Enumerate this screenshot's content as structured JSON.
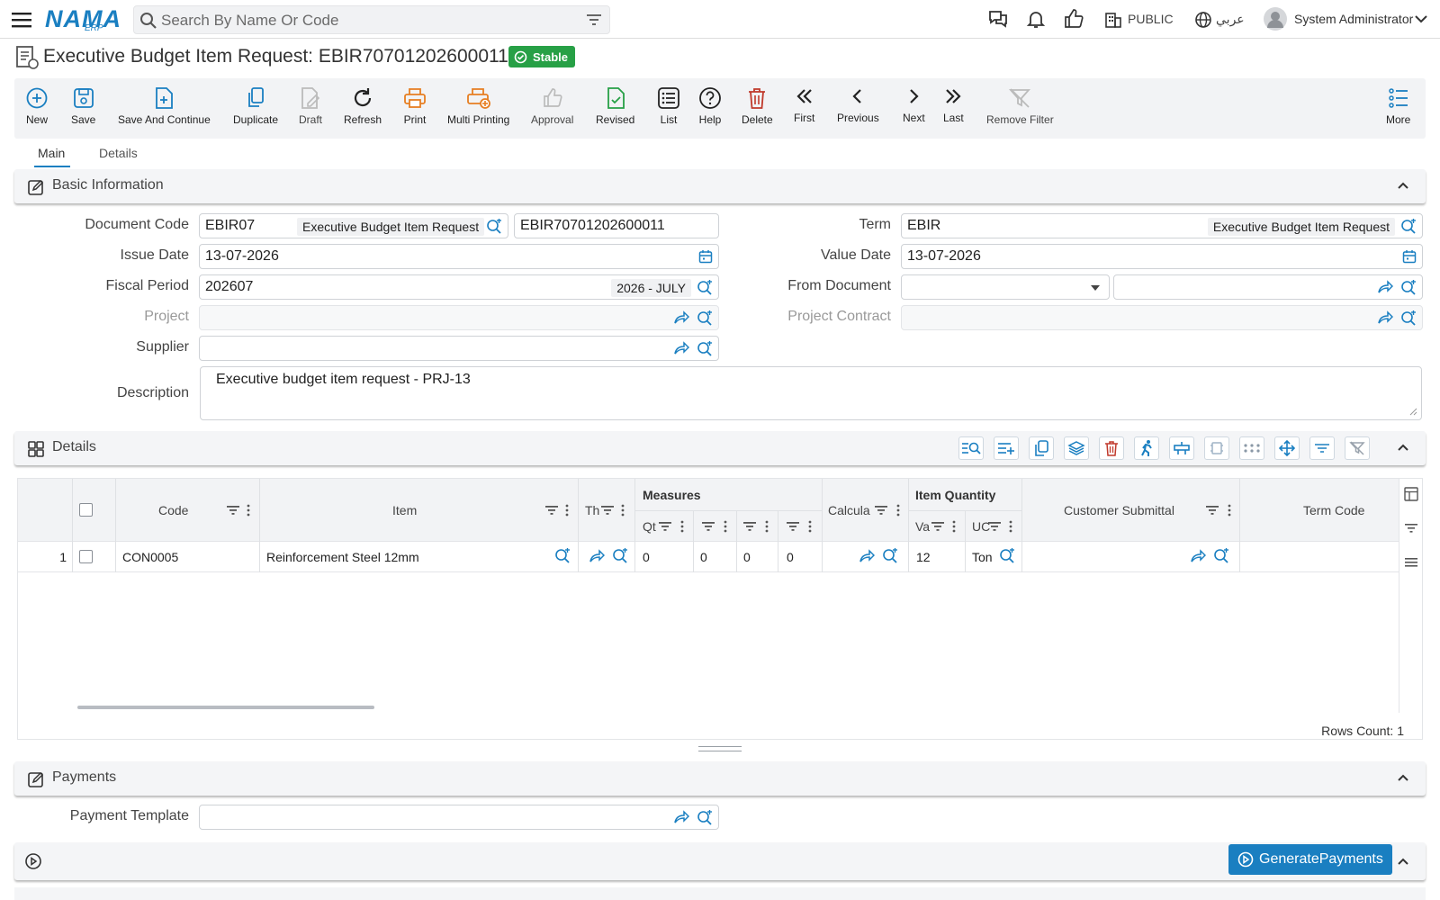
{
  "topbar": {
    "logo_text": "NAMA",
    "logo_sub": "ERP",
    "search_placeholder": "Search By Name Or Code",
    "branch": "PUBLIC",
    "language": "عربي",
    "user": "System Administrator"
  },
  "page": {
    "title": "Executive Budget Item Request: EBIR70701202600011",
    "status": "Stable"
  },
  "toolbar": {
    "new": "New",
    "save": "Save",
    "save_continue": "Save And Continue",
    "duplicate": "Duplicate",
    "draft": "Draft",
    "refresh": "Refresh",
    "print": "Print",
    "multi_printing": "Multi Printing",
    "approval": "Approval",
    "revised": "Revised",
    "list": "List",
    "help": "Help",
    "delete": "Delete",
    "first": "First",
    "previous": "Previous",
    "next": "Next",
    "last": "Last",
    "remove_filter": "Remove Filter",
    "more": "More"
  },
  "tabs": {
    "main": "Main",
    "details": "Details"
  },
  "basic": {
    "header": "Basic Information",
    "document_code_label": "Document Code",
    "document_code": "EBIR07",
    "document_code_name": "Executive Budget Item Request",
    "document_number": "EBIR70701202600011",
    "term_label": "Term",
    "term": "EBIR",
    "term_name": "Executive Budget Item Request",
    "issue_date_label": "Issue Date",
    "issue_date": "13-07-2026",
    "value_date_label": "Value Date",
    "value_date": "13-07-2026",
    "fiscal_period_label": "Fiscal Period",
    "fiscal_period": "202607",
    "fiscal_period_name": "2026 - JULY",
    "from_document_label": "From Document",
    "project_label": "Project",
    "project_contract_label": "Project Contract",
    "supplier_label": "Supplier",
    "description_label": "Description",
    "description": "Executive budget item request - PRJ-13"
  },
  "details": {
    "header": "Details",
    "columns": {
      "code": "Code",
      "item": "Item",
      "th": "Th",
      "measures": "Measures",
      "qty": "Qt",
      "calcul": "Calcula",
      "item_quantity": "Item Quantity",
      "va": "Va",
      "uom": "UC",
      "customer_submittal": "Customer Submittal",
      "term_code": "Term Code"
    },
    "rows": [
      {
        "num": "1",
        "code": "CON0005",
        "item": "Reinforcement Steel 12mm",
        "m1": "0",
        "m2": "0",
        "m3": "0",
        "m4": "0",
        "value": "12",
        "uom": "Ton"
      }
    ],
    "rows_count": "Rows Count: 1"
  },
  "payments": {
    "header": "Payments",
    "template_label": "Payment Template",
    "generate_button": "GeneratePayments"
  },
  "colors": {
    "accent": "#1a7fc1",
    "stable": "#27a046",
    "danger": "#c0392b",
    "print": "#e67e22"
  }
}
